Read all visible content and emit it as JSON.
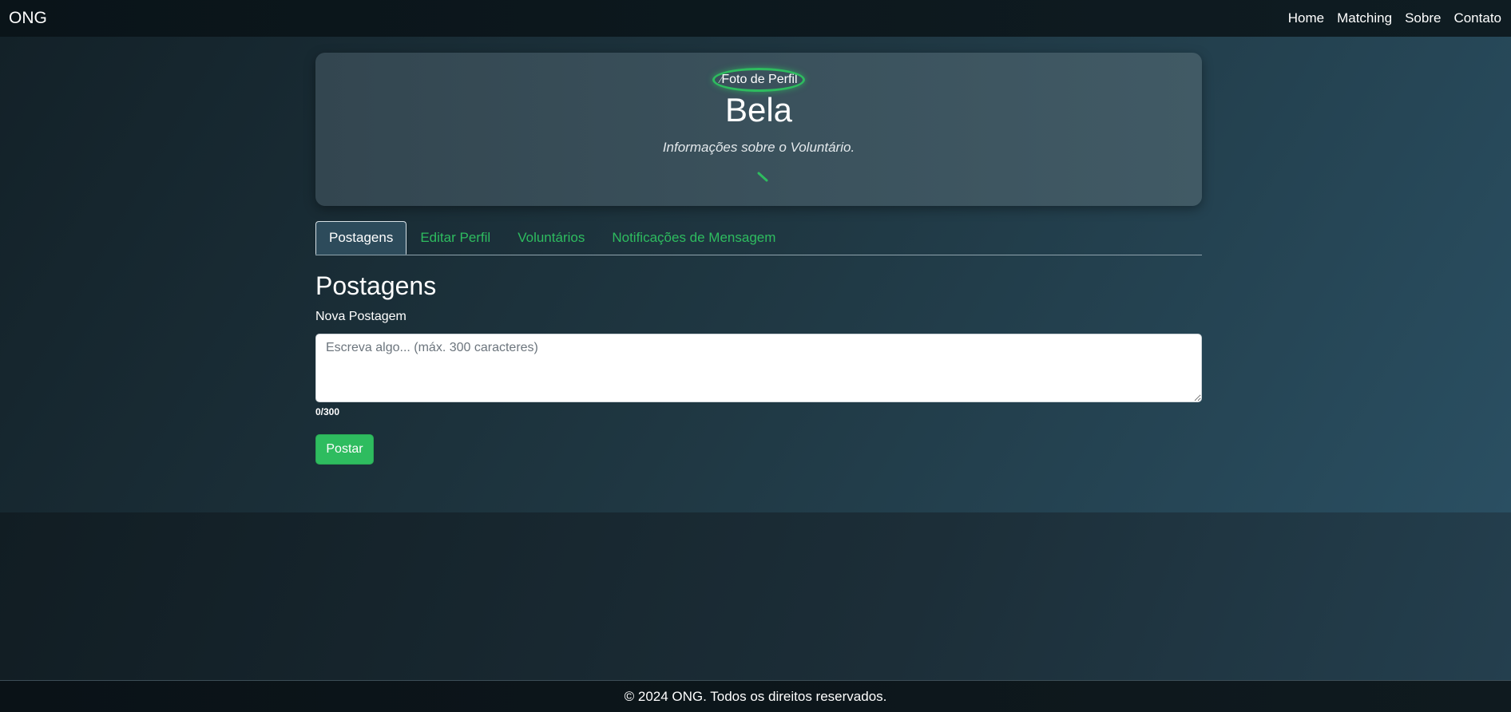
{
  "navbar": {
    "brand": "ONG",
    "links": [
      "Home",
      "Matching",
      "Sobre",
      "Contato"
    ]
  },
  "profile": {
    "photo_alt": "Foto de Perfil",
    "name": "Bela",
    "info": "Informações sobre o Voluntário."
  },
  "tabs": [
    {
      "label": "Postagens",
      "active": true
    },
    {
      "label": "Editar Perfil",
      "active": false
    },
    {
      "label": "Voluntários",
      "active": false
    },
    {
      "label": "Notificações de Mensagem",
      "active": false
    }
  ],
  "posts": {
    "title": "Postagens",
    "new_post_label": "Nova Postagem",
    "placeholder": "Escreva algo... (máx. 300 caracteres)",
    "value": "",
    "char_count": "0/300",
    "submit_label": "Postar"
  },
  "footer": {
    "text": "© 2024 ONG. Todos os direitos reservados."
  },
  "colors": {
    "accent": "#2ebc5f",
    "navbar_bg": "#0d181d",
    "card_bg": "#3b525d"
  }
}
